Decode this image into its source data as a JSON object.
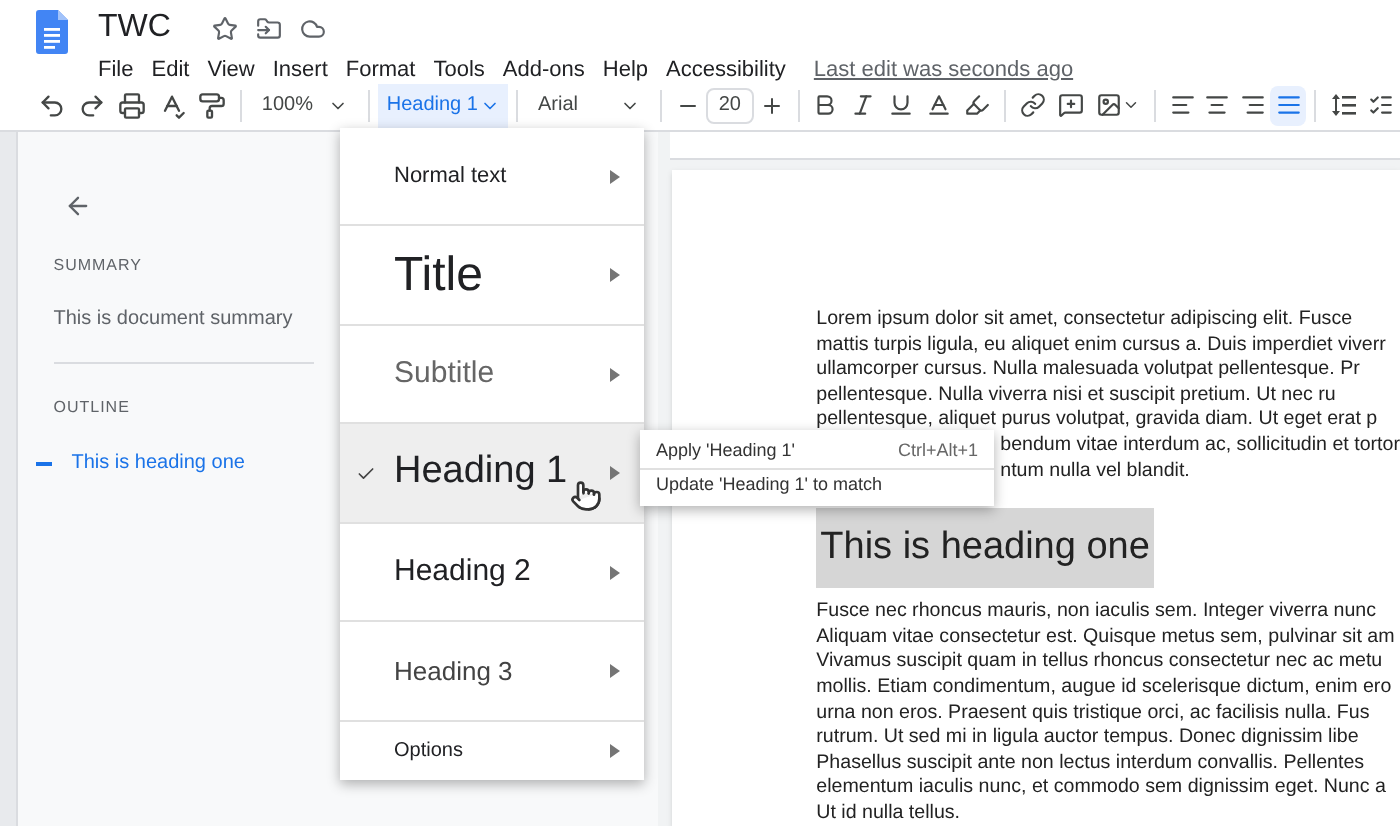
{
  "document": {
    "title": "TWC",
    "last_edit": "Last edit was seconds ago"
  },
  "menu_bar": [
    "File",
    "Edit",
    "View",
    "Insert",
    "Format",
    "Tools",
    "Add-ons",
    "Help",
    "Accessibility"
  ],
  "toolbar": {
    "zoom": "100%",
    "style": "Heading 1",
    "font": "Arial",
    "font_size": "20",
    "alignment": [
      {
        "kind": "left",
        "selected": false
      },
      {
        "kind": "center",
        "selected": false
      },
      {
        "kind": "right",
        "selected": false
      },
      {
        "kind": "justify",
        "selected": true
      }
    ]
  },
  "side_panel": {
    "summary_label": "SUMMARY",
    "summary": "This is document summary",
    "outline_label": "OUTLINE",
    "outline": [
      {
        "label": "This is heading one",
        "selected": true
      }
    ]
  },
  "style_menu": [
    {
      "kind": "normal",
      "label": "Normal text",
      "selected": false
    },
    {
      "kind": "title",
      "label": "Title",
      "selected": false
    },
    {
      "kind": "subtitle",
      "label": "Subtitle",
      "selected": false
    },
    {
      "kind": "heading1",
      "label": "Heading 1",
      "selected": true
    },
    {
      "kind": "heading2",
      "label": "Heading 2",
      "selected": false
    },
    {
      "kind": "heading3",
      "label": "Heading 3",
      "selected": false
    },
    {
      "kind": "options",
      "label": "Options",
      "selected": false
    }
  ],
  "submenu": [
    {
      "label": "Apply 'Heading 1'",
      "shortcut": "Ctrl+Alt+1"
    },
    {
      "label": "Update 'Heading 1' to match"
    }
  ],
  "page": {
    "paragraph_1": [
      {
        "kind": "line",
        "text": "Lorem ipsum dolor sit amet, consectetur adipiscing elit. Fusce"
      },
      {
        "kind": "line",
        "text": "mattis turpis ligula, eu aliquet enim cursus a. Duis imperdiet viverr"
      },
      {
        "kind": "line",
        "text": "ullamcorper cursus. Nulla malesuada volutpat pellentesque. Pr"
      },
      {
        "kind": "line",
        "text": "pellentesque. Nulla viverra nisi et suscipit pretium. Ut nec ru"
      },
      {
        "kind": "line",
        "text": "pellentesque, aliquet purus volutpat, gravida diam. Ut eget erat p"
      },
      {
        "kind": "covered",
        "text": "bendum vitae interdum ac, sollicitudin et tortor"
      },
      {
        "kind": "covered",
        "text": "ntum nulla vel blandit."
      }
    ],
    "heading": "This is heading one",
    "paragraph_2": [
      {
        "kind": "line",
        "text": "Fusce nec rhoncus mauris, non iaculis sem. Integer viverra nunc"
      },
      {
        "kind": "line",
        "text": "Aliquam vitae consectetur est. Quisque metus sem, pulvinar sit am"
      },
      {
        "kind": "line",
        "text": "Vivamus suscipit quam in tellus rhoncus consectetur nec ac metu"
      },
      {
        "kind": "line",
        "text": "mollis. Etiam condimentum, augue id scelerisque dictum, enim ero"
      },
      {
        "kind": "line",
        "text": "urna non eros. Praesent quis tristique orci, ac facilisis nulla. Fus"
      },
      {
        "kind": "line",
        "text": "rutrum. Ut sed mi in ligula auctor tempus. Donec dignissim libe"
      },
      {
        "kind": "line",
        "text": "Phasellus suscipit ante non lectus interdum convallis. Pellentes"
      },
      {
        "kind": "line",
        "text": "elementum iaculis nunc, et commodo sem dignissim eget. Nunc a"
      },
      {
        "kind": "line",
        "text": "Ut id nulla tellus."
      }
    ]
  }
}
